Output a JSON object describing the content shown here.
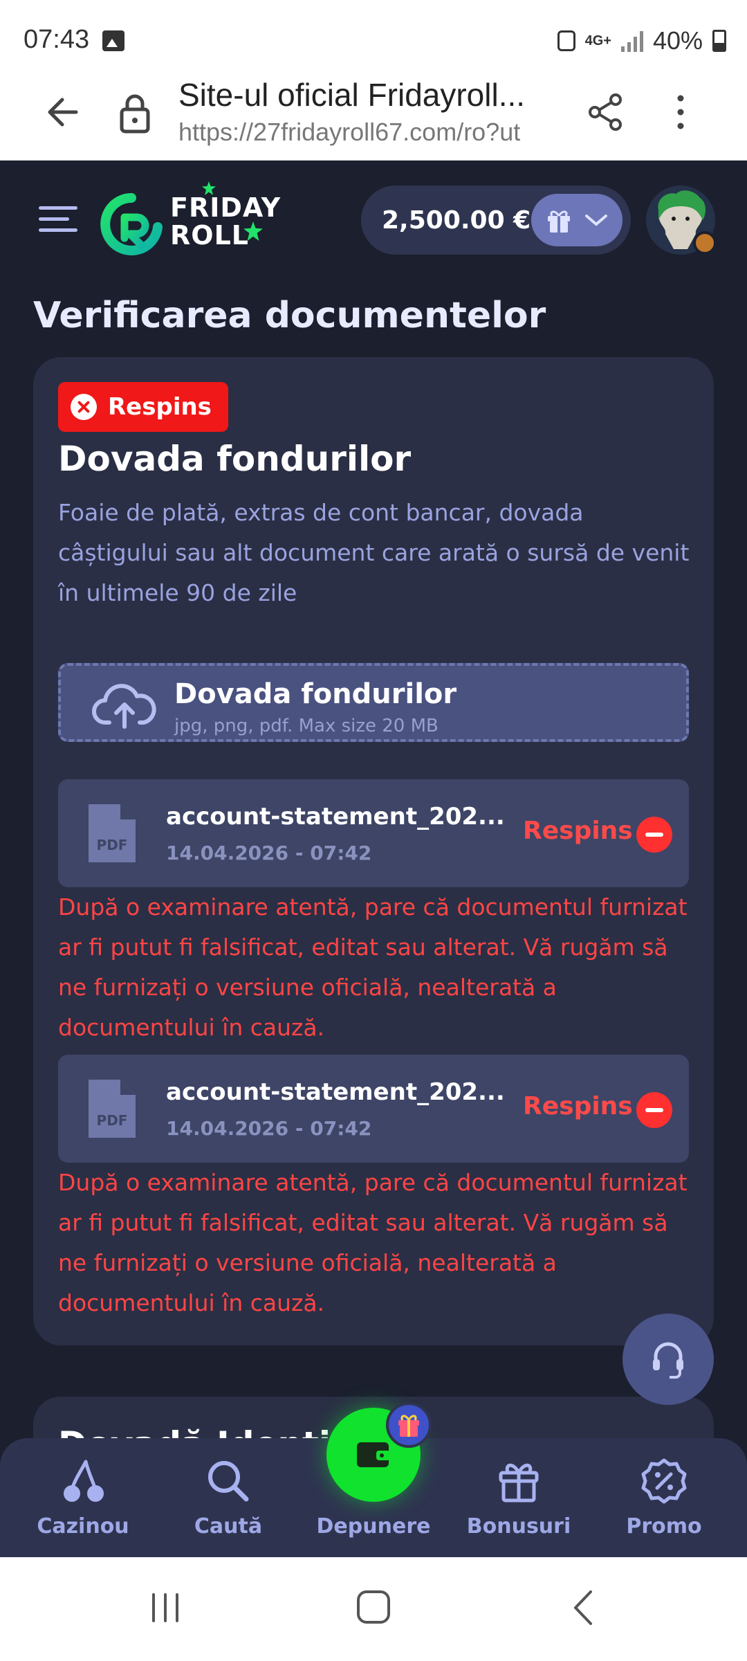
{
  "status_bar": {
    "time": "07:43",
    "network": "4G+",
    "battery": "40%"
  },
  "browser": {
    "title": "Site-ul oficial Fridayroll...",
    "url": "https://27fridayroll67.com/ro?ut"
  },
  "header": {
    "logo_line1": "FRIDAY",
    "logo_line2": "ROLL",
    "balance": "2,500.00 €"
  },
  "page": {
    "title": "Verificarea documentelor"
  },
  "card": {
    "status": "Respins",
    "title": "Dovada fondurilor",
    "description": "Foaie de plată, extras de cont bancar, dovada câștigului sau alt document care arată o sursă de venit în ultimele 90 de zile",
    "upload": {
      "title": "Dovada fondurilor",
      "hint": "jpg, png, pdf. Max size 20 MB"
    },
    "files": [
      {
        "name": "account-statement_202...",
        "date": "14.04.2026 - 07:42",
        "status": "Respins",
        "error": "După o examinare atentă, pare că documentul furnizat ar fi putut fi falsificat, editat sau alterat. Vă rugăm să ne furnizați o versiune oficială, nealterată a documentului în cauză."
      },
      {
        "name": "account-statement_202...",
        "date": "14.04.2026 - 07:42",
        "status": "Respins",
        "error": "După o examinare atentă, pare că documentul furnizat ar fi putut fi falsificat, editat sau alterat. Vă rugăm să ne furnizați o versiune oficială, nealterată a documentului în cauză."
      }
    ]
  },
  "next_card": {
    "title_partial": "Dovadă Identi"
  },
  "bottom_nav": {
    "items": [
      {
        "label": "Cazinou",
        "icon": "cherries-icon"
      },
      {
        "label": "Caută",
        "icon": "search-icon"
      },
      {
        "label": "Depunere",
        "icon": "wallet-icon"
      },
      {
        "label": "Bonusuri",
        "icon": "gift-icon"
      },
      {
        "label": "Promo",
        "icon": "percent-badge-icon"
      }
    ]
  },
  "colors": {
    "background": "#1b1f2e",
    "card": "#2a2f45",
    "accent_green": "#10e22d",
    "rejected_red": "#f01818",
    "text_muted": "#9aa3e0"
  }
}
